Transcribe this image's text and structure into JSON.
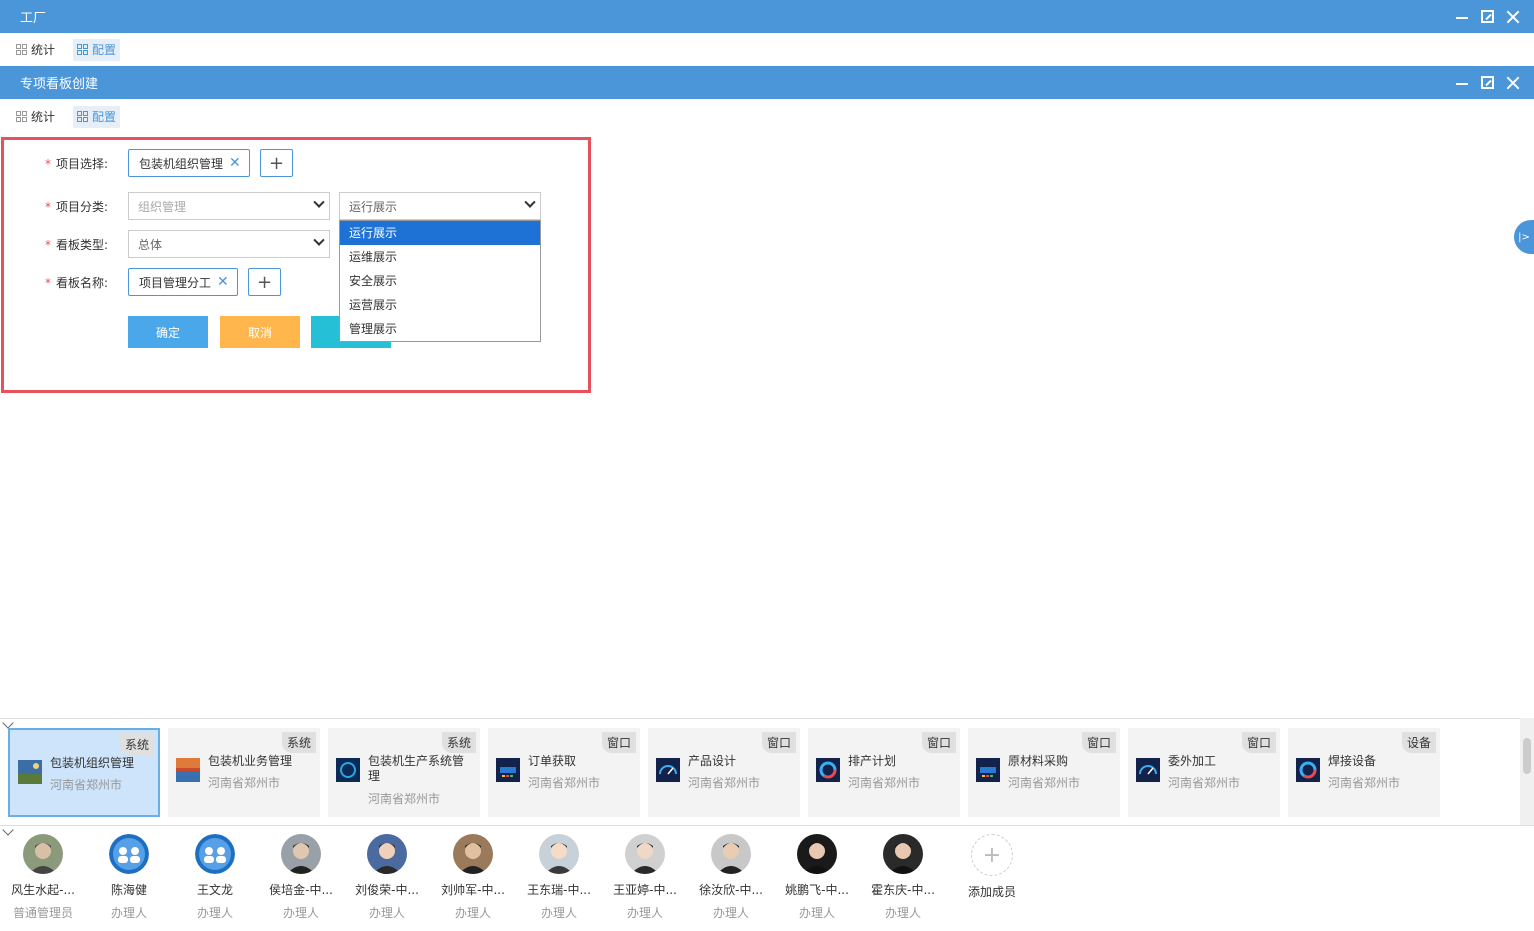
{
  "window1": {
    "title": "工厂"
  },
  "window2": {
    "title": "专项看板创建"
  },
  "tabs": [
    {
      "label": "统计"
    },
    {
      "label": "配置"
    }
  ],
  "form": {
    "project_select": {
      "label": "项目选择:",
      "tag": "包装机组织管理"
    },
    "project_category": {
      "label": "项目分类:",
      "primary_value": "组织管理",
      "secondary_value": "运行展示",
      "options": [
        "运行展示",
        "运维展示",
        "安全展示",
        "运营展示",
        "管理展示"
      ]
    },
    "board_type": {
      "label": "看板类型:",
      "value": "总体"
    },
    "board_name": {
      "label": "看板名称:",
      "tag": "项目管理分工"
    },
    "confirm_label": "确定",
    "cancel_label": "取消",
    "third_label": ""
  },
  "side_toggle": "|>",
  "cards": [
    {
      "title": "包装机组织管理",
      "location": "河南省郑州市",
      "badge": "系统"
    },
    {
      "title": "包装机业务管理",
      "location": "河南省郑州市",
      "badge": "系统"
    },
    {
      "title": "包装机生产系统管理",
      "location": "河南省郑州市",
      "badge": "系统"
    },
    {
      "title": "订单获取",
      "location": "河南省郑州市",
      "badge": "窗口"
    },
    {
      "title": "产品设计",
      "location": "河南省郑州市",
      "badge": "窗口"
    },
    {
      "title": "排产计划",
      "location": "河南省郑州市",
      "badge": "窗口"
    },
    {
      "title": "原材料采购",
      "location": "河南省郑州市",
      "badge": "窗口"
    },
    {
      "title": "委外加工",
      "location": "河南省郑州市",
      "badge": "窗口"
    },
    {
      "title": "焊接设备",
      "location": "河南省郑州市",
      "badge": "设备"
    }
  ],
  "members": [
    {
      "name": "风生水起-...",
      "role": "普通管理员"
    },
    {
      "name": "陈海健",
      "role": "办理人"
    },
    {
      "name": "王文龙",
      "role": "办理人"
    },
    {
      "name": "侯培金-中...",
      "role": "办理人"
    },
    {
      "name": "刘俊荣-中...",
      "role": "办理人"
    },
    {
      "name": "刘帅军-中...",
      "role": "办理人"
    },
    {
      "name": "王东瑞-中...",
      "role": "办理人"
    },
    {
      "name": "王亚婷-中...",
      "role": "办理人"
    },
    {
      "name": "徐汝欣-中...",
      "role": "办理人"
    },
    {
      "name": "姚鹏飞-中...",
      "role": "办理人"
    },
    {
      "name": "霍东庆-中...",
      "role": "办理人"
    }
  ],
  "add_member_label": "添加成员"
}
